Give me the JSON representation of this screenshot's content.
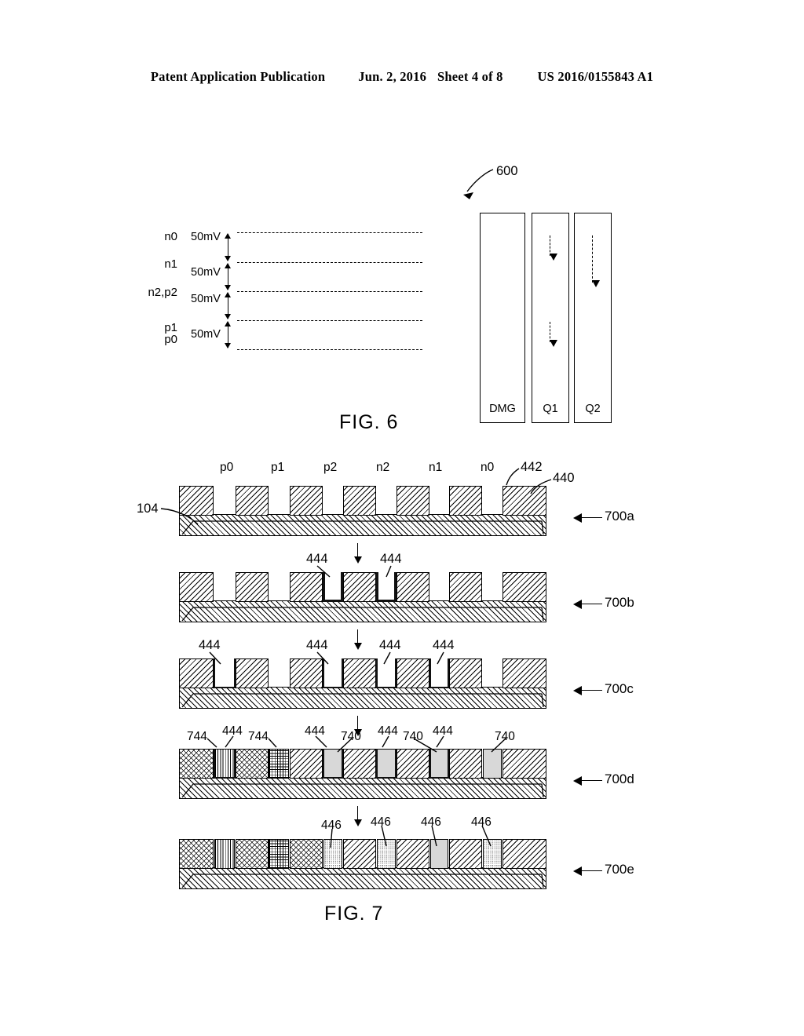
{
  "header": {
    "publication": "Patent Application Publication",
    "date": "Jun. 2, 2016",
    "sheet": "Sheet 4 of 8",
    "number": "US 2016/0155843 A1"
  },
  "fig6": {
    "caption": "FIG. 6",
    "ref_number": "600",
    "levels": [
      {
        "label": "n0",
        "gap_label": "50mV"
      },
      {
        "label": "n1",
        "gap_label": "50mV"
      },
      {
        "label": "n2,p2",
        "gap_label": "50mV"
      },
      {
        "label": "p1",
        "gap_label": "50mV"
      },
      {
        "label": "p0",
        "gap_label": ""
      }
    ],
    "gaps": [
      "50mV",
      "50mV",
      "50mV",
      "50mV"
    ],
    "columns": [
      {
        "label": "DMG",
        "arrows": 0
      },
      {
        "label": "Q1",
        "arrows": 2
      },
      {
        "label": "Q2",
        "arrows": 1
      }
    ]
  },
  "fig7": {
    "caption": "FIG. 7",
    "column_labels": [
      "p0",
      "p1",
      "p2",
      "n2",
      "n1",
      "n0"
    ],
    "rows": [
      {
        "tag": "700a",
        "refs": [
          {
            "text": "104"
          },
          {
            "text": "442"
          },
          {
            "text": "440"
          }
        ]
      },
      {
        "tag": "700b",
        "refs": [
          {
            "text": "444"
          },
          {
            "text": "444"
          }
        ]
      },
      {
        "tag": "700c",
        "refs": [
          {
            "text": "444"
          },
          {
            "text": "444"
          },
          {
            "text": "444"
          },
          {
            "text": "444"
          }
        ]
      },
      {
        "tag": "700d",
        "refs": [
          {
            "text": "744"
          },
          {
            "text": "444"
          },
          {
            "text": "744"
          },
          {
            "text": "444"
          },
          {
            "text": "740"
          },
          {
            "text": "444"
          },
          {
            "text": "740"
          },
          {
            "text": "444"
          },
          {
            "text": "740"
          }
        ]
      },
      {
        "tag": "700e",
        "refs": [
          {
            "text": "446"
          },
          {
            "text": "446"
          },
          {
            "text": "446"
          },
          {
            "text": "446"
          }
        ]
      }
    ]
  }
}
